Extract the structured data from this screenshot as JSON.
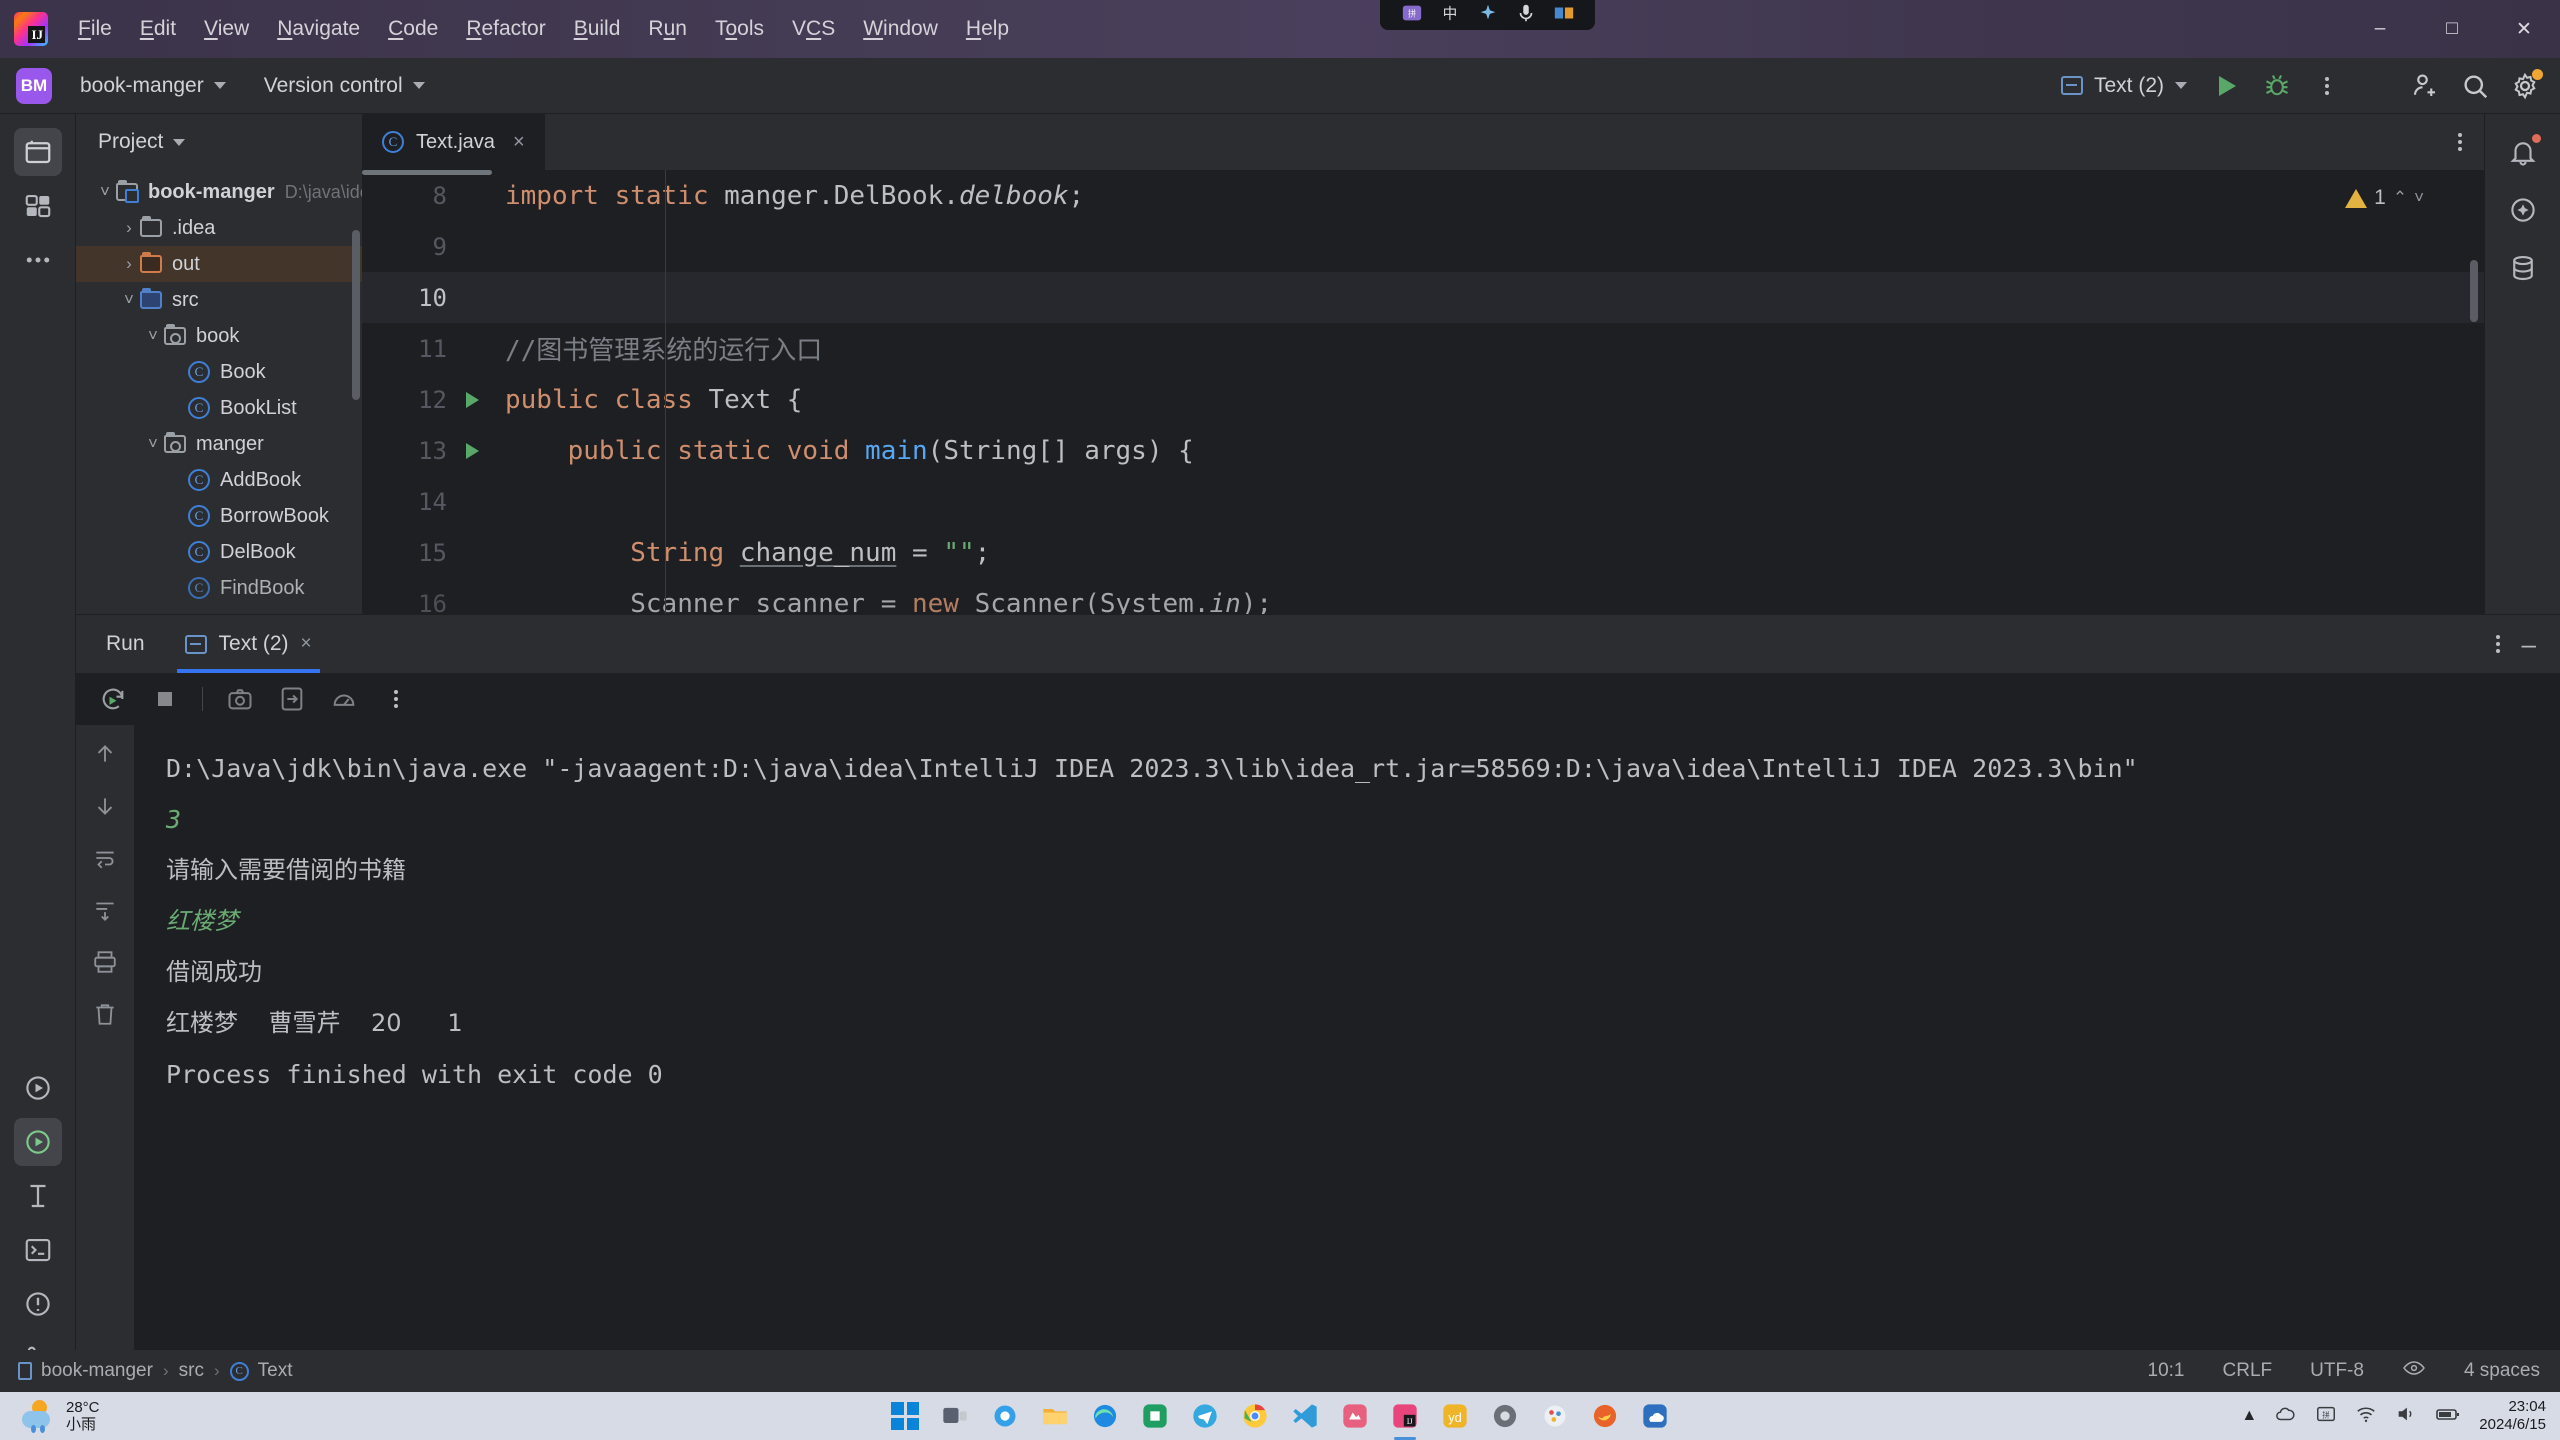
{
  "menubar": {
    "app_icon": "intellij-logo",
    "items": [
      "File",
      "Edit",
      "View",
      "Navigate",
      "Code",
      "Refactor",
      "Build",
      "Run",
      "Tools",
      "VCS",
      "Window",
      "Help"
    ],
    "center_widget_icons": [
      "ime-indicator",
      "chinese-input-icon",
      "sparkle-icon",
      "microphone-icon",
      "keyboard-icon"
    ],
    "window_controls": [
      "minimize",
      "maximize",
      "close"
    ]
  },
  "toolbar": {
    "project_badge": "BM",
    "project_name": "book-manger",
    "version_control": "Version control",
    "run_config": "Text (2)",
    "run_button": "run-icon",
    "debug_button": "debug-icon",
    "more_button": "more-vertical-icon",
    "account_button": "add-account-icon",
    "search_button": "search-icon",
    "settings_button": "settings-gear-icon"
  },
  "left_strip": {
    "buttons": [
      "project-tool-window",
      "commit-tool-window",
      "more-tool-windows"
    ],
    "bottom_buttons": [
      "run-tool-window",
      "debug-tool-window",
      "structure-tool-window",
      "terminal-tool-window",
      "problems-tool-window",
      "version-control-tool-window"
    ]
  },
  "right_strip": {
    "buttons": [
      "notifications-icon",
      "ai-assistant-icon",
      "database-icon"
    ]
  },
  "project_panel": {
    "title": "Project",
    "tree": [
      {
        "label": "book-manger",
        "path": "D:\\java\\ide",
        "depth": 0,
        "arrow": "down",
        "icon": "module-root",
        "selected": false
      },
      {
        "label": ".idea",
        "path": "",
        "depth": 1,
        "arrow": "right",
        "icon": "folder-plain",
        "selected": false
      },
      {
        "label": "out",
        "path": "",
        "depth": 1,
        "arrow": "right",
        "icon": "folder-excluded",
        "selected": true
      },
      {
        "label": "src",
        "path": "",
        "depth": 1,
        "arrow": "down",
        "icon": "folder-source",
        "selected": false
      },
      {
        "label": "book",
        "path": "",
        "depth": 2,
        "arrow": "down",
        "icon": "package",
        "selected": false
      },
      {
        "label": "Book",
        "path": "",
        "depth": 3,
        "arrow": "none",
        "icon": "java-class",
        "selected": false
      },
      {
        "label": "BookList",
        "path": "",
        "depth": 3,
        "arrow": "none",
        "icon": "java-class",
        "selected": false
      },
      {
        "label": "manger",
        "path": "",
        "depth": 2,
        "arrow": "down",
        "icon": "package",
        "selected": false
      },
      {
        "label": "AddBook",
        "path": "",
        "depth": 3,
        "arrow": "none",
        "icon": "java-class",
        "selected": false
      },
      {
        "label": "BorrowBook",
        "path": "",
        "depth": 3,
        "arrow": "none",
        "icon": "java-class",
        "selected": false
      },
      {
        "label": "DelBook",
        "path": "",
        "depth": 3,
        "arrow": "none",
        "icon": "java-class",
        "selected": false
      },
      {
        "label": "FindBook",
        "path": "",
        "depth": 3,
        "arrow": "none",
        "icon": "java-class",
        "selected": false
      }
    ]
  },
  "editor": {
    "tab": {
      "label": "Text.java",
      "icon": "java-class",
      "close": "×"
    },
    "warning_count": "1",
    "lines": [
      {
        "no": "8",
        "current": false,
        "gutter_run": false
      },
      {
        "no": "9",
        "current": false,
        "gutter_run": false
      },
      {
        "no": "10",
        "current": true,
        "gutter_run": false
      },
      {
        "no": "11",
        "current": false,
        "gutter_run": false
      },
      {
        "no": "12",
        "current": false,
        "gutter_run": true
      },
      {
        "no": "13",
        "current": false,
        "gutter_run": true
      },
      {
        "no": "14",
        "current": false,
        "gutter_run": false
      },
      {
        "no": "15",
        "current": false,
        "gutter_run": false
      },
      {
        "no": "16",
        "current": false,
        "gutter_run": false
      }
    ],
    "code": {
      "l8_kw": "import static ",
      "l8_rest": "manger.DelBook.",
      "l8_ital": "delbook",
      "l8_end": ";",
      "l10": "",
      "l11": "//图书管理系统的运行入口",
      "l12_kw": "public class ",
      "l12_rest": "Text {",
      "l13_kw": "public static void ",
      "l13_fn": "main",
      "l13_rest": "(String[] args) {",
      "l15_kw": "String ",
      "l15_var": "change_num",
      "l15_eq": " = ",
      "l15_str": "\"\"",
      "l15_end": ";",
      "l16_a": "Scanner scanner = ",
      "l16_kw": "new ",
      "l16_b": "Scanner(System.",
      "l16_ital": "in",
      "l16_c": ");"
    }
  },
  "run_window": {
    "label": "Run",
    "tab": "Text (2)",
    "tab_close": "×",
    "toolbar_icons": [
      "rerun-icon",
      "stop-icon",
      "camera-icon",
      "export-icon",
      "profiler-icon",
      "more-vertical-icon"
    ],
    "gutter_icons": [
      "scroll-up-icon",
      "scroll-down-icon",
      "soft-wrap-icon",
      "scroll-to-end-icon",
      "print-icon",
      "clear-all-icon"
    ],
    "console": [
      {
        "text": "D:\\Java\\jdk\\bin\\java.exe \"-javaagent:D:\\java\\idea\\IntelliJ IDEA 2023.3\\lib\\idea_rt.jar=58569:D:\\java\\idea\\IntelliJ IDEA 2023.3\\bin\"",
        "style": "normal"
      },
      {
        "text": "3",
        "style": "input"
      },
      {
        "text": "请输入需要借阅的书籍",
        "style": "cjk"
      },
      {
        "text": "红楼梦",
        "style": "input-cjk"
      },
      {
        "text": "借阅成功",
        "style": "cjk"
      },
      {
        "text": "红楼梦    曹雪芹    20      1",
        "style": "cjk"
      },
      {
        "text": "",
        "style": "normal"
      },
      {
        "text": "Process finished with exit code 0",
        "style": "normal"
      }
    ]
  },
  "statusbar": {
    "breadcrumbs": [
      "book-manger",
      "src",
      "Text"
    ],
    "caret": "10:1",
    "line_sep": "CRLF",
    "encoding": "UTF-8",
    "indent": "4 spaces",
    "inspection_icon": "inspections-eye-icon"
  },
  "taskbar": {
    "weather_temp": "28°C",
    "weather_desc": "小雨",
    "apps": [
      "start-windows",
      "task-view",
      "widgets",
      "file-explorer",
      "edge-browser",
      "app-green",
      "telegram",
      "chrome",
      "vscode",
      "pink-app",
      "intellij-idea",
      "yd-dict",
      "circle-app",
      "paint-app",
      "firefox",
      "cloud-app"
    ],
    "time": "23:04",
    "date": "2024/6/15",
    "tray_icons": [
      "show-hidden-icons",
      "onedrive-icon",
      "input-method-icon",
      "network-icon",
      "volume-icon",
      "battery-icon"
    ]
  }
}
